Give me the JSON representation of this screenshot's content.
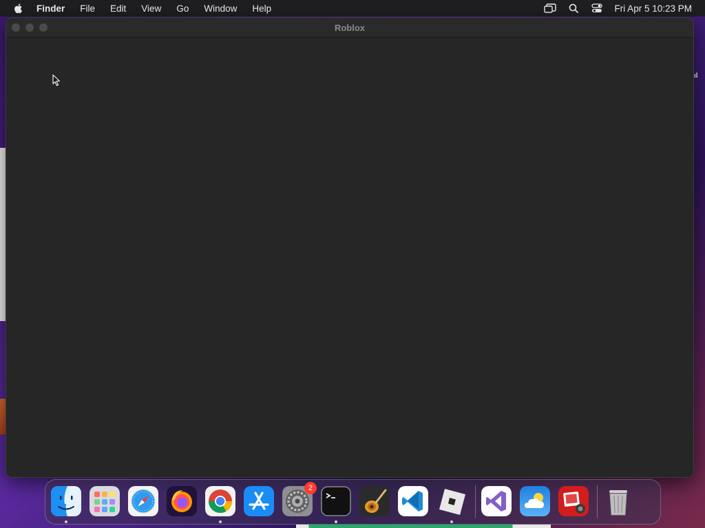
{
  "menubar": {
    "app_name": "Finder",
    "menus": [
      "File",
      "Edit",
      "View",
      "Go",
      "Window",
      "Help"
    ],
    "clock": "Fri Apr 5  10:23 PM",
    "status_icons": [
      "screen-mirroring-icon",
      "spotlight-search-icon",
      "control-center-icon"
    ]
  },
  "window": {
    "title": "Roblox"
  },
  "dock": {
    "items": [
      {
        "name": "Finder",
        "icon": "finder-icon",
        "running": true
      },
      {
        "name": "Launchpad",
        "icon": "launchpad-icon",
        "running": false
      },
      {
        "name": "Safari",
        "icon": "safari-icon",
        "running": false
      },
      {
        "name": "Firefox",
        "icon": "firefox-icon",
        "running": false
      },
      {
        "name": "Google Chrome",
        "icon": "chrome-icon",
        "running": true
      },
      {
        "name": "App Store",
        "icon": "app-store-icon",
        "running": false
      },
      {
        "name": "System Preferences",
        "icon": "system-preferences-icon",
        "running": false,
        "badge": "2"
      },
      {
        "name": "Terminal",
        "icon": "terminal-icon",
        "running": true
      },
      {
        "name": "GarageBand",
        "icon": "garageband-icon",
        "running": false
      },
      {
        "name": "Visual Studio Code",
        "icon": "vscode-icon",
        "running": false
      },
      {
        "name": "Roblox",
        "icon": "roblox-icon",
        "running": true
      },
      {
        "name": "Visual Studio",
        "icon": "visual-studio-icon",
        "running": false
      },
      {
        "name": "Weather",
        "icon": "weather-icon",
        "running": false
      },
      {
        "name": "Photo Booth",
        "icon": "photo-booth-icon",
        "running": false
      },
      {
        "name": "Trash",
        "icon": "trash-icon",
        "running": false
      }
    ]
  },
  "colors": {
    "menubar_bg": "#1f1f22",
    "window_bg": "#262626",
    "badge": "#ff3b30"
  }
}
